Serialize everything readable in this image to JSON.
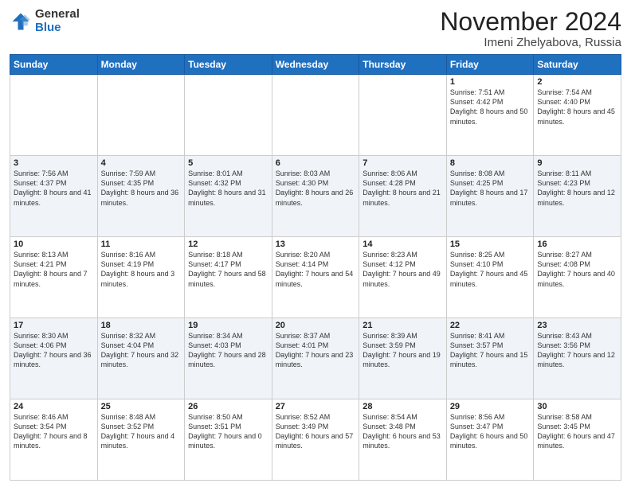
{
  "logo": {
    "general": "General",
    "blue": "Blue"
  },
  "header": {
    "month": "November 2024",
    "location": "Imeni Zhelyabova, Russia"
  },
  "weekdays": [
    "Sunday",
    "Monday",
    "Tuesday",
    "Wednesday",
    "Thursday",
    "Friday",
    "Saturday"
  ],
  "weeks": [
    [
      null,
      null,
      null,
      null,
      null,
      {
        "day": "1",
        "sunrise": "Sunrise: 7:51 AM",
        "sunset": "Sunset: 4:42 PM",
        "daylight": "Daylight: 8 hours and 50 minutes."
      },
      {
        "day": "2",
        "sunrise": "Sunrise: 7:54 AM",
        "sunset": "Sunset: 4:40 PM",
        "daylight": "Daylight: 8 hours and 45 minutes."
      }
    ],
    [
      {
        "day": "3",
        "sunrise": "Sunrise: 7:56 AM",
        "sunset": "Sunset: 4:37 PM",
        "daylight": "Daylight: 8 hours and 41 minutes."
      },
      {
        "day": "4",
        "sunrise": "Sunrise: 7:59 AM",
        "sunset": "Sunset: 4:35 PM",
        "daylight": "Daylight: 8 hours and 36 minutes."
      },
      {
        "day": "5",
        "sunrise": "Sunrise: 8:01 AM",
        "sunset": "Sunset: 4:32 PM",
        "daylight": "Daylight: 8 hours and 31 minutes."
      },
      {
        "day": "6",
        "sunrise": "Sunrise: 8:03 AM",
        "sunset": "Sunset: 4:30 PM",
        "daylight": "Daylight: 8 hours and 26 minutes."
      },
      {
        "day": "7",
        "sunrise": "Sunrise: 8:06 AM",
        "sunset": "Sunset: 4:28 PM",
        "daylight": "Daylight: 8 hours and 21 minutes."
      },
      {
        "day": "8",
        "sunrise": "Sunrise: 8:08 AM",
        "sunset": "Sunset: 4:25 PM",
        "daylight": "Daylight: 8 hours and 17 minutes."
      },
      {
        "day": "9",
        "sunrise": "Sunrise: 8:11 AM",
        "sunset": "Sunset: 4:23 PM",
        "daylight": "Daylight: 8 hours and 12 minutes."
      }
    ],
    [
      {
        "day": "10",
        "sunrise": "Sunrise: 8:13 AM",
        "sunset": "Sunset: 4:21 PM",
        "daylight": "Daylight: 8 hours and 7 minutes."
      },
      {
        "day": "11",
        "sunrise": "Sunrise: 8:16 AM",
        "sunset": "Sunset: 4:19 PM",
        "daylight": "Daylight: 8 hours and 3 minutes."
      },
      {
        "day": "12",
        "sunrise": "Sunrise: 8:18 AM",
        "sunset": "Sunset: 4:17 PM",
        "daylight": "Daylight: 7 hours and 58 minutes."
      },
      {
        "day": "13",
        "sunrise": "Sunrise: 8:20 AM",
        "sunset": "Sunset: 4:14 PM",
        "daylight": "Daylight: 7 hours and 54 minutes."
      },
      {
        "day": "14",
        "sunrise": "Sunrise: 8:23 AM",
        "sunset": "Sunset: 4:12 PM",
        "daylight": "Daylight: 7 hours and 49 minutes."
      },
      {
        "day": "15",
        "sunrise": "Sunrise: 8:25 AM",
        "sunset": "Sunset: 4:10 PM",
        "daylight": "Daylight: 7 hours and 45 minutes."
      },
      {
        "day": "16",
        "sunrise": "Sunrise: 8:27 AM",
        "sunset": "Sunset: 4:08 PM",
        "daylight": "Daylight: 7 hours and 40 minutes."
      }
    ],
    [
      {
        "day": "17",
        "sunrise": "Sunrise: 8:30 AM",
        "sunset": "Sunset: 4:06 PM",
        "daylight": "Daylight: 7 hours and 36 minutes."
      },
      {
        "day": "18",
        "sunrise": "Sunrise: 8:32 AM",
        "sunset": "Sunset: 4:04 PM",
        "daylight": "Daylight: 7 hours and 32 minutes."
      },
      {
        "day": "19",
        "sunrise": "Sunrise: 8:34 AM",
        "sunset": "Sunset: 4:03 PM",
        "daylight": "Daylight: 7 hours and 28 minutes."
      },
      {
        "day": "20",
        "sunrise": "Sunrise: 8:37 AM",
        "sunset": "Sunset: 4:01 PM",
        "daylight": "Daylight: 7 hours and 23 minutes."
      },
      {
        "day": "21",
        "sunrise": "Sunrise: 8:39 AM",
        "sunset": "Sunset: 3:59 PM",
        "daylight": "Daylight: 7 hours and 19 minutes."
      },
      {
        "day": "22",
        "sunrise": "Sunrise: 8:41 AM",
        "sunset": "Sunset: 3:57 PM",
        "daylight": "Daylight: 7 hours and 15 minutes."
      },
      {
        "day": "23",
        "sunrise": "Sunrise: 8:43 AM",
        "sunset": "Sunset: 3:56 PM",
        "daylight": "Daylight: 7 hours and 12 minutes."
      }
    ],
    [
      {
        "day": "24",
        "sunrise": "Sunrise: 8:46 AM",
        "sunset": "Sunset: 3:54 PM",
        "daylight": "Daylight: 7 hours and 8 minutes."
      },
      {
        "day": "25",
        "sunrise": "Sunrise: 8:48 AM",
        "sunset": "Sunset: 3:52 PM",
        "daylight": "Daylight: 7 hours and 4 minutes."
      },
      {
        "day": "26",
        "sunrise": "Sunrise: 8:50 AM",
        "sunset": "Sunset: 3:51 PM",
        "daylight": "Daylight: 7 hours and 0 minutes."
      },
      {
        "day": "27",
        "sunrise": "Sunrise: 8:52 AM",
        "sunset": "Sunset: 3:49 PM",
        "daylight": "Daylight: 6 hours and 57 minutes."
      },
      {
        "day": "28",
        "sunrise": "Sunrise: 8:54 AM",
        "sunset": "Sunset: 3:48 PM",
        "daylight": "Daylight: 6 hours and 53 minutes."
      },
      {
        "day": "29",
        "sunrise": "Sunrise: 8:56 AM",
        "sunset": "Sunset: 3:47 PM",
        "daylight": "Daylight: 6 hours and 50 minutes."
      },
      {
        "day": "30",
        "sunrise": "Sunrise: 8:58 AM",
        "sunset": "Sunset: 3:45 PM",
        "daylight": "Daylight: 6 hours and 47 minutes."
      }
    ]
  ]
}
